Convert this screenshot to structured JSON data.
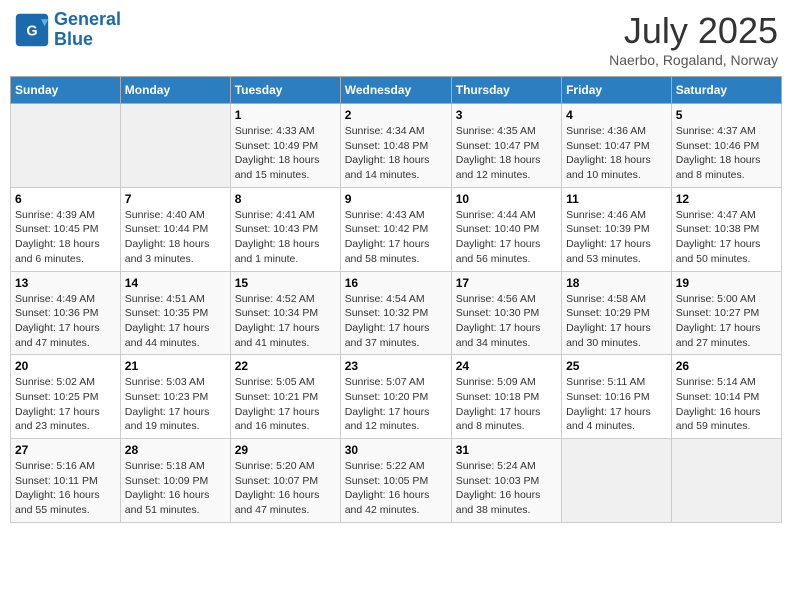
{
  "header": {
    "logo_line1": "General",
    "logo_line2": "Blue",
    "month": "July 2025",
    "location": "Naerbo, Rogaland, Norway"
  },
  "weekdays": [
    "Sunday",
    "Monday",
    "Tuesday",
    "Wednesday",
    "Thursday",
    "Friday",
    "Saturday"
  ],
  "weeks": [
    [
      {
        "day": "",
        "info": ""
      },
      {
        "day": "",
        "info": ""
      },
      {
        "day": "1",
        "info": "Sunrise: 4:33 AM\nSunset: 10:49 PM\nDaylight: 18 hours and 15 minutes."
      },
      {
        "day": "2",
        "info": "Sunrise: 4:34 AM\nSunset: 10:48 PM\nDaylight: 18 hours and 14 minutes."
      },
      {
        "day": "3",
        "info": "Sunrise: 4:35 AM\nSunset: 10:47 PM\nDaylight: 18 hours and 12 minutes."
      },
      {
        "day": "4",
        "info": "Sunrise: 4:36 AM\nSunset: 10:47 PM\nDaylight: 18 hours and 10 minutes."
      },
      {
        "day": "5",
        "info": "Sunrise: 4:37 AM\nSunset: 10:46 PM\nDaylight: 18 hours and 8 minutes."
      }
    ],
    [
      {
        "day": "6",
        "info": "Sunrise: 4:39 AM\nSunset: 10:45 PM\nDaylight: 18 hours and 6 minutes."
      },
      {
        "day": "7",
        "info": "Sunrise: 4:40 AM\nSunset: 10:44 PM\nDaylight: 18 hours and 3 minutes."
      },
      {
        "day": "8",
        "info": "Sunrise: 4:41 AM\nSunset: 10:43 PM\nDaylight: 18 hours and 1 minute."
      },
      {
        "day": "9",
        "info": "Sunrise: 4:43 AM\nSunset: 10:42 PM\nDaylight: 17 hours and 58 minutes."
      },
      {
        "day": "10",
        "info": "Sunrise: 4:44 AM\nSunset: 10:40 PM\nDaylight: 17 hours and 56 minutes."
      },
      {
        "day": "11",
        "info": "Sunrise: 4:46 AM\nSunset: 10:39 PM\nDaylight: 17 hours and 53 minutes."
      },
      {
        "day": "12",
        "info": "Sunrise: 4:47 AM\nSunset: 10:38 PM\nDaylight: 17 hours and 50 minutes."
      }
    ],
    [
      {
        "day": "13",
        "info": "Sunrise: 4:49 AM\nSunset: 10:36 PM\nDaylight: 17 hours and 47 minutes."
      },
      {
        "day": "14",
        "info": "Sunrise: 4:51 AM\nSunset: 10:35 PM\nDaylight: 17 hours and 44 minutes."
      },
      {
        "day": "15",
        "info": "Sunrise: 4:52 AM\nSunset: 10:34 PM\nDaylight: 17 hours and 41 minutes."
      },
      {
        "day": "16",
        "info": "Sunrise: 4:54 AM\nSunset: 10:32 PM\nDaylight: 17 hours and 37 minutes."
      },
      {
        "day": "17",
        "info": "Sunrise: 4:56 AM\nSunset: 10:30 PM\nDaylight: 17 hours and 34 minutes."
      },
      {
        "day": "18",
        "info": "Sunrise: 4:58 AM\nSunset: 10:29 PM\nDaylight: 17 hours and 30 minutes."
      },
      {
        "day": "19",
        "info": "Sunrise: 5:00 AM\nSunset: 10:27 PM\nDaylight: 17 hours and 27 minutes."
      }
    ],
    [
      {
        "day": "20",
        "info": "Sunrise: 5:02 AM\nSunset: 10:25 PM\nDaylight: 17 hours and 23 minutes."
      },
      {
        "day": "21",
        "info": "Sunrise: 5:03 AM\nSunset: 10:23 PM\nDaylight: 17 hours and 19 minutes."
      },
      {
        "day": "22",
        "info": "Sunrise: 5:05 AM\nSunset: 10:21 PM\nDaylight: 17 hours and 16 minutes."
      },
      {
        "day": "23",
        "info": "Sunrise: 5:07 AM\nSunset: 10:20 PM\nDaylight: 17 hours and 12 minutes."
      },
      {
        "day": "24",
        "info": "Sunrise: 5:09 AM\nSunset: 10:18 PM\nDaylight: 17 hours and 8 minutes."
      },
      {
        "day": "25",
        "info": "Sunrise: 5:11 AM\nSunset: 10:16 PM\nDaylight: 17 hours and 4 minutes."
      },
      {
        "day": "26",
        "info": "Sunrise: 5:14 AM\nSunset: 10:14 PM\nDaylight: 16 hours and 59 minutes."
      }
    ],
    [
      {
        "day": "27",
        "info": "Sunrise: 5:16 AM\nSunset: 10:11 PM\nDaylight: 16 hours and 55 minutes."
      },
      {
        "day": "28",
        "info": "Sunrise: 5:18 AM\nSunset: 10:09 PM\nDaylight: 16 hours and 51 minutes."
      },
      {
        "day": "29",
        "info": "Sunrise: 5:20 AM\nSunset: 10:07 PM\nDaylight: 16 hours and 47 minutes."
      },
      {
        "day": "30",
        "info": "Sunrise: 5:22 AM\nSunset: 10:05 PM\nDaylight: 16 hours and 42 minutes."
      },
      {
        "day": "31",
        "info": "Sunrise: 5:24 AM\nSunset: 10:03 PM\nDaylight: 16 hours and 38 minutes."
      },
      {
        "day": "",
        "info": ""
      },
      {
        "day": "",
        "info": ""
      }
    ]
  ]
}
